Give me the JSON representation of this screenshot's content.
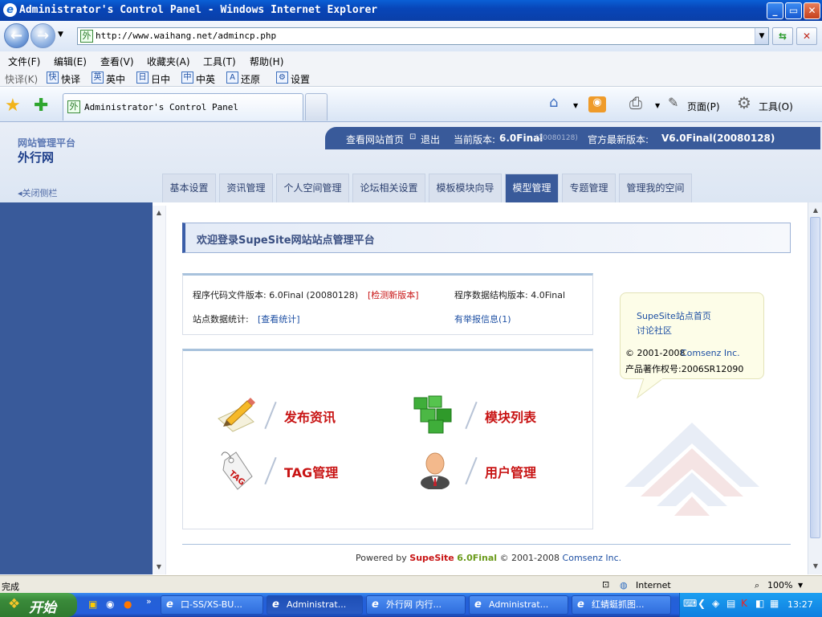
{
  "window": {
    "title": "Administrator's Control Panel - Windows Internet Explorer",
    "min": "_",
    "max": "▭",
    "close": "✕"
  },
  "address": {
    "url": "http://www.waihang.net/admincp.php",
    "favicon": "外"
  },
  "menu": [
    "文件(F)",
    "编辑(E)",
    "查看(V)",
    "收藏夹(A)",
    "工具(T)",
    "帮助(H)"
  ],
  "quickbar": {
    "label": "快译(K)",
    "items": [
      {
        "icon": "快",
        "label": "快译"
      },
      {
        "icon": "英",
        "label": "英中"
      },
      {
        "icon": "日",
        "label": "日中"
      },
      {
        "icon": "中",
        "label": "中英"
      },
      {
        "icon": "A",
        "label": "还原"
      },
      {
        "icon": "⚙",
        "label": "设置"
      }
    ]
  },
  "tab": {
    "title": "Administrator's Control Panel"
  },
  "toolbar": {
    "page": "页面(P)",
    "tools": "工具(O)"
  },
  "header": {
    "brand_small": "网站管理平台",
    "brand_big": "外行网",
    "view_site": "查看网站首页",
    "logout": "退出",
    "current_version_label": "当前版本:",
    "current_version": "6.0Final",
    "current_build": "(20080128)",
    "latest_label": "官方最新版本:",
    "latest_version": "V6.0Final(20080128)",
    "close_sidebar": "◂关闭侧栏"
  },
  "nav": [
    "基本设置",
    "资讯管理",
    "个人空间管理",
    "论坛相关设置",
    "模板模块向导",
    "模型管理",
    "专题管理",
    "管理我的空间"
  ],
  "nav_active_index": 5,
  "main": {
    "welcome": "欢迎登录SupeSite网站站点管理平台",
    "code_version": "程序代码文件版本: 6.0Final (20080128)",
    "check_update": "[检测新版本]",
    "db_version": "程序数据结构版本: 4.0Final",
    "stats_label": "站点数据统计:",
    "stats_link": "[查看统计]",
    "reports": "有举报信息(1)",
    "quick": [
      {
        "label": "发布资讯",
        "icon": "pencil-paper-icon"
      },
      {
        "label": "模块列表",
        "icon": "green-blocks-icon"
      },
      {
        "label": "TAG管理",
        "icon": "tag-icon"
      },
      {
        "label": "用户管理",
        "icon": "user-icon"
      }
    ]
  },
  "side": {
    "link1": "SupeSite站点首页",
    "link2": "讨论社区",
    "copyright": "© 2001-2008",
    "company": "Comsenz Inc.",
    "license": "产品著作权号:2006SR12090"
  },
  "footer": {
    "powered": "Powered by",
    "product": "SupeSite",
    "version": "6.0Final",
    "copy": "© 2001-2008",
    "company": "Comsenz Inc."
  },
  "status": {
    "text": "完成",
    "zone": "Internet",
    "zoom": "100%"
  },
  "taskbar": {
    "start": "开始",
    "items": [
      "口-SS/XS-BU...",
      "Administrat...",
      "外行网 内行...",
      "Administrat...",
      "红蜻蜓抓图..."
    ],
    "active_index": 1,
    "clock": "13:27"
  },
  "colors": {
    "accent": "#395a9a",
    "quick_label": "#c81414",
    "link": "#1d4fa3"
  }
}
